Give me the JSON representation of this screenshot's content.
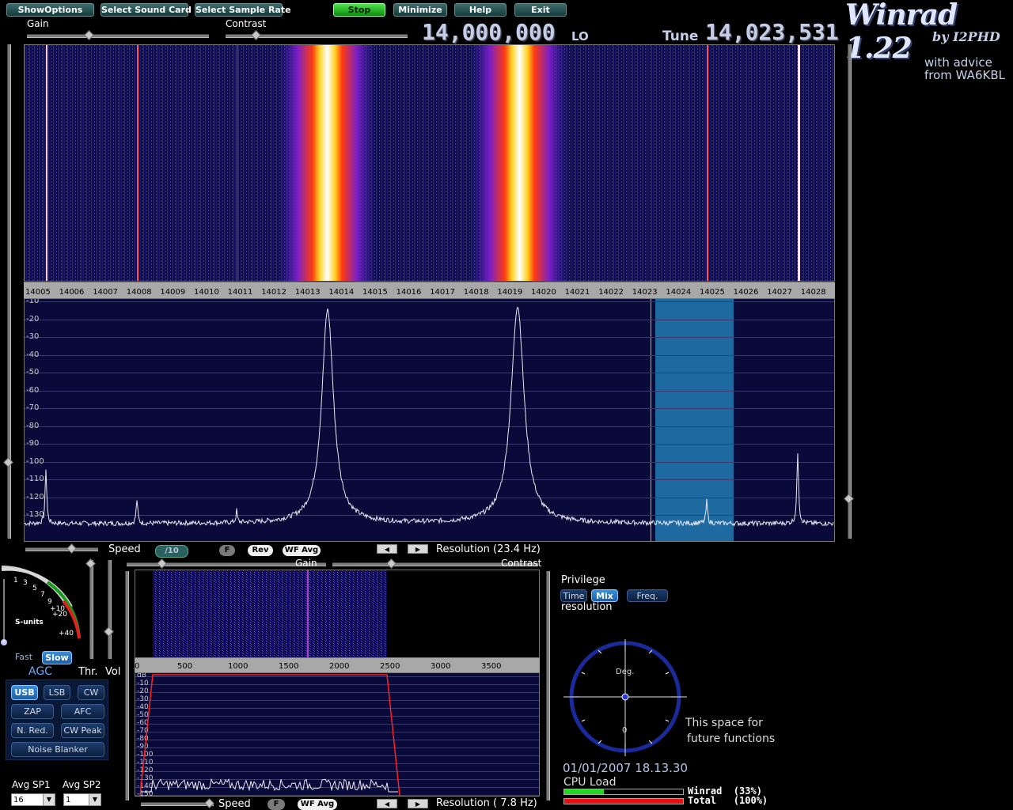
{
  "toolbar": {
    "show_options": "ShowOptions",
    "select_sound_card": "Select Sound Card",
    "select_sample_rate": "Select Sample Rate",
    "stop": "Stop",
    "minimize": "Minimize",
    "help": "Help",
    "exit": "Exit"
  },
  "sliders": {
    "gain": "Gain",
    "contrast": "Contrast"
  },
  "freq": {
    "lo_value": "14,000,000",
    "lo_label": "LO",
    "tune_label": "Tune",
    "tune_value": "14,023,531"
  },
  "branding": {
    "title": "Winrad 1.22",
    "byline": "by I2PHD",
    "advice_1": "with advice",
    "advice_2": "from WA6KBL"
  },
  "main_spectrum": {
    "freq_ticks": [
      "14005",
      "14006",
      "14007",
      "14008",
      "14009",
      "14010",
      "14011",
      "14012",
      "14013",
      "14014",
      "14015",
      "14016",
      "14017",
      "14018",
      "14019",
      "14020",
      "14021",
      "14022",
      "14023",
      "14024",
      "14025",
      "14026",
      "14027",
      "14028"
    ],
    "db_ticks": [
      "-10",
      "-20",
      "-30",
      "-40",
      "-50",
      "-60",
      "-70",
      "-80",
      "-90",
      "-100",
      "-110",
      "-120",
      "-130"
    ],
    "speed_label": "Speed",
    "speed_div": "/10",
    "f_label": "F",
    "rev_label": "Rev",
    "wf_avg_label": "WF Avg",
    "resolution": "Resolution (23.4 Hz)",
    "gain_label": "Gain",
    "contrast_label": "Contrast"
  },
  "smeter": {
    "scale": [
      "1",
      "3",
      "5",
      "7",
      "9",
      "+10",
      "+20",
      "+40"
    ],
    "label": "S-units"
  },
  "agc": {
    "fast": "Fast",
    "slow": "Slow",
    "label": "AGC",
    "thr": "Thr.",
    "vol": "Vol"
  },
  "modes": {
    "usb": "USB",
    "lsb": "LSB",
    "cw": "CW",
    "zap": "ZAP",
    "afc": "AFC",
    "nred": "N. Red.",
    "cwpeak": "CW Peak",
    "noise_blanker": "Noise Blanker"
  },
  "avg": {
    "sp1_label": "Avg SP1",
    "sp2_label": "Avg SP2",
    "sp1_value": "16",
    "sp2_value": "1"
  },
  "audio_spectrum": {
    "freq_ticks": [
      "0",
      "500",
      "1000",
      "1500",
      "2000",
      "2500",
      "3000",
      "3500"
    ],
    "db_ticks": [
      "dB",
      "-10",
      "-20",
      "-30",
      "-40",
      "-50",
      "-60",
      "-70",
      "-80",
      "-90",
      "-100",
      "-110",
      "-120",
      "-130",
      "-140",
      "-150"
    ],
    "speed_label": "Speed",
    "f_label": "F",
    "wf_avg_label": "WF Avg",
    "resolution": "Resolution ( 7.8 Hz)"
  },
  "privilege": {
    "title": "Privilege",
    "time": "Time",
    "mix": "Mix",
    "freq": "Freq.",
    "resolution": "resolution"
  },
  "scope": {
    "deg_label": "Deg.",
    "zero_label": "0",
    "future_1": "This space for",
    "future_2": "future functions"
  },
  "status": {
    "datetime": "01/01/2007 18.13.30",
    "cpu_label": "CPU Load",
    "winrad_load": "Winrad  (33%)",
    "total_load": "Total   (100%)",
    "winrad_fraction": 0.33,
    "total_fraction": 1.0
  },
  "colors": {
    "accent_green": "#21d821",
    "accent_red": "#e81010",
    "plot_bg": "#0a0a3a",
    "highlight_band": "#1e6aa0"
  }
}
